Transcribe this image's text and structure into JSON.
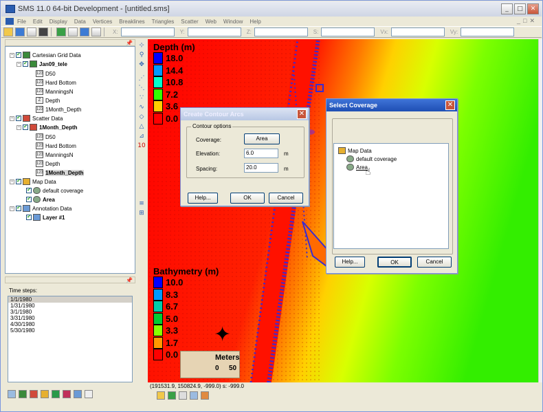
{
  "window": {
    "title": "SMS 11.0 64-bit Development - [untitled.sms]"
  },
  "menu": [
    "File",
    "Edit",
    "Display",
    "Data",
    "Vertices",
    "Breaklines",
    "Triangles",
    "Scatter",
    "Web",
    "Window",
    "Help"
  ],
  "coords": {
    "x_label": "X:",
    "y_label": "Y:",
    "z_label": "Z:",
    "s_label": "S:",
    "vx_label": "Vx:",
    "vy_label": "Vy:"
  },
  "tree": {
    "cartesian_grid": "Cartesian Grid Data",
    "grid_name": "Jan09_tele",
    "grid_datasets": [
      "D50",
      "Hard Bottom",
      "ManningsN",
      "Depth",
      "1Month_Depth"
    ],
    "scatter_data": "Scatter Data",
    "scatter_name": "1Month_Depth",
    "scatter_datasets": [
      "D50",
      "Hard Bottom",
      "ManningsN",
      "Depth",
      "1Month_Depth"
    ],
    "map_data": "Map Data",
    "coverages": [
      "default coverage",
      "Area"
    ],
    "annotation_data": "Annotation Data",
    "layer": "Layer #1"
  },
  "time_steps": {
    "label": "Time steps:",
    "items": [
      "1/1/1980",
      "1/31/1980",
      "3/1/1980",
      "3/31/1980",
      "4/30/1980",
      "5/30/1980"
    ]
  },
  "legend_depth": {
    "title": "Depth (m)",
    "values": [
      "18.0",
      "14.4",
      "10.8",
      "7.2",
      "3.6",
      "0.0"
    ],
    "colors": [
      "#0000ff",
      "#0099ff",
      "#00ffcc",
      "#33ff00",
      "#ffcc00",
      "#ff0000"
    ]
  },
  "legend_bathy": {
    "title": "Bathymetry (m)",
    "values": [
      "10.0",
      "8.3",
      "6.7",
      "5.0",
      "3.3",
      "1.7",
      "0.0"
    ],
    "colors": [
      "#0000ff",
      "#0099ff",
      "#00ccaa",
      "#00cc33",
      "#88ff00",
      "#ffee00",
      "#ff9900",
      "#ff0000"
    ]
  },
  "scale": {
    "unit": "Meters",
    "left": "0",
    "right": "50"
  },
  "status": "(191531.9, 150824.9, -999.0) s: -999.0",
  "contour_dialog": {
    "title": "Create Contour Arcs",
    "group": "Contour options",
    "coverage_label": "Coverage:",
    "coverage_button": "Area",
    "elevation_label": "Elevation:",
    "elevation_value": "6.0",
    "elevation_unit": "m",
    "spacing_label": "Spacing:",
    "spacing_value": "20.0",
    "spacing_unit": "m",
    "help": "Help...",
    "ok": "OK",
    "cancel": "Cancel"
  },
  "select_dialog": {
    "title": "Select Coverage",
    "root": "Map Data",
    "items": [
      "default coverage",
      "Area"
    ],
    "help": "Help...",
    "ok": "OK",
    "cancel": "Cancel"
  }
}
